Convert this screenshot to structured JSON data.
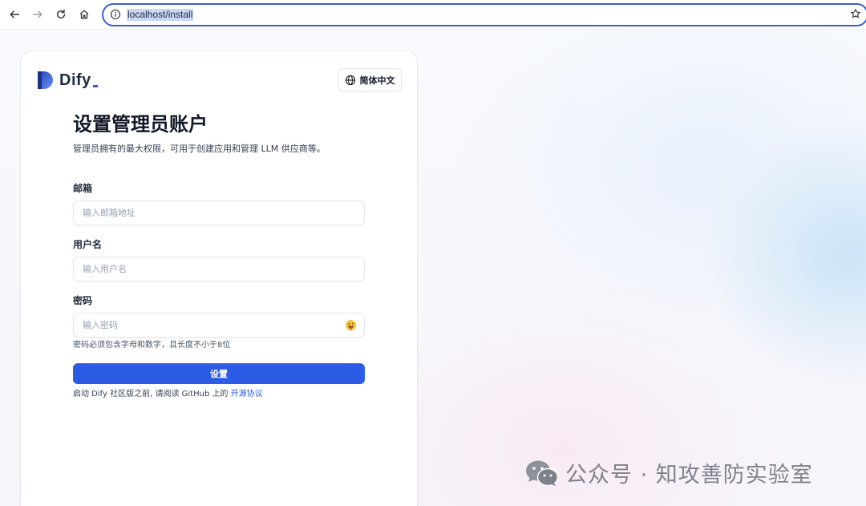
{
  "browser": {
    "url": "localhost/install",
    "nav": {
      "back": "back-arrow-icon",
      "forward": "forward-arrow-icon",
      "reload": "reload-icon",
      "home": "home-icon"
    }
  },
  "brand": {
    "name": "Dify",
    "accent": "#2c5ce6"
  },
  "language_button": {
    "label": "简体中文",
    "icon": "globe-icon"
  },
  "form": {
    "title": "设置管理员账户",
    "subtitle": "管理员拥有的最大权限，可用于创建应用和管理 LLM 供应商等。",
    "email": {
      "label": "邮箱",
      "placeholder": "输入邮箱地址",
      "value": ""
    },
    "username": {
      "label": "用户名",
      "placeholder": "输入用户名",
      "value": ""
    },
    "password": {
      "label": "密码",
      "placeholder": "输入密码",
      "value": "",
      "toggle_icon": "😛"
    },
    "password_hint": "密码必须包含字母和数字，且长度不小于8位",
    "submit_label": "设置",
    "agreement_prefix": "启动 Dify 社区版之前, 请阅读 GitHub 上的",
    "agreement_link": "开源协议"
  },
  "watermark": {
    "text": "公众号 · 知攻善防实验室",
    "icon": "wechat-icon"
  }
}
